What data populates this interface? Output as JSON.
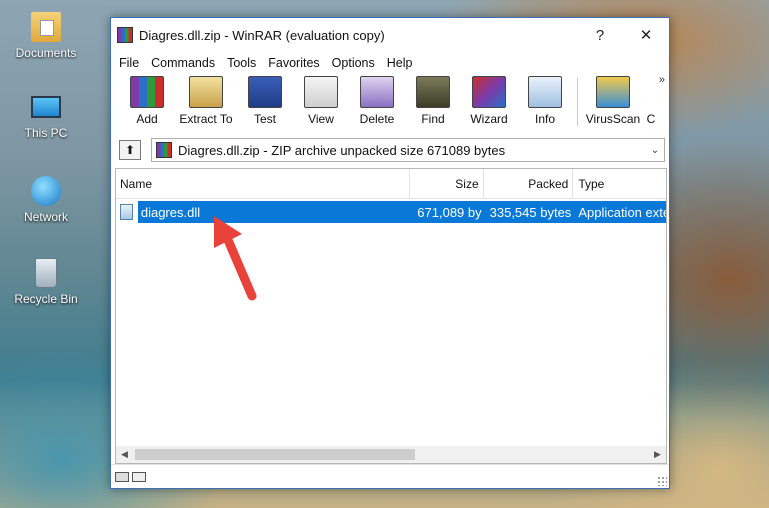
{
  "desktop": {
    "icons": [
      {
        "label": "Documents",
        "icon": "documents-folder-icon"
      },
      {
        "label": "This PC",
        "icon": "this-pc-icon"
      },
      {
        "label": "Network",
        "icon": "network-icon"
      },
      {
        "label": "Recycle Bin",
        "icon": "recycle-bin-icon"
      }
    ]
  },
  "window": {
    "title": "Diagres.dll.zip - WinRAR (evaluation copy)",
    "help_btn": "?",
    "close_btn": "✕"
  },
  "menu": [
    "File",
    "Commands",
    "Tools",
    "Favorites",
    "Options",
    "Help"
  ],
  "toolbar": {
    "buttons": [
      "Add",
      "Extract To",
      "Test",
      "View",
      "Delete",
      "Find",
      "Wizard",
      "Info",
      "VirusScan",
      "C"
    ],
    "overflow": "»"
  },
  "address": {
    "up": "⬆",
    "path": "Diagres.dll.zip - ZIP archive unpacked size 671089 bytes",
    "dropdown": "⌄"
  },
  "columns": {
    "name": "Name",
    "size": "Size",
    "packed": "Packed",
    "type": "Type",
    "sort_caret": "⌃"
  },
  "files": [
    {
      "name": "diagres.dll",
      "size": "671,089 by",
      "packed": "335,545 bytes",
      "type": "Application exte"
    }
  ],
  "scroll": {
    "left": "◀",
    "right": "▶"
  },
  "colors": {
    "selection": "#0a78d7",
    "arrow": "#e8423a",
    "window_border": "#3d6fb6"
  }
}
